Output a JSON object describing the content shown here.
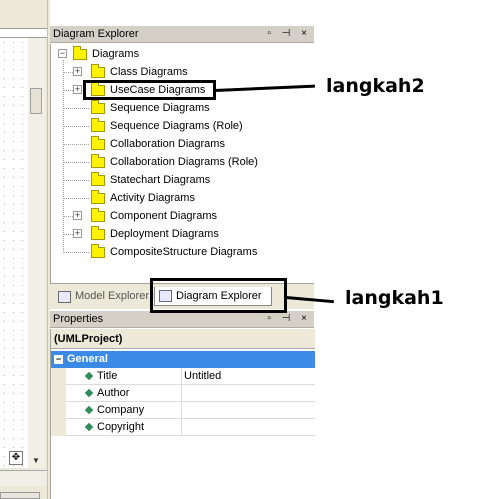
{
  "diagram_explorer": {
    "title": "Diagram Explorer",
    "panel_buttons": "▫ ⊣ ×",
    "root": "Diagrams",
    "items": [
      {
        "label": "Class Diagrams",
        "expandable": true
      },
      {
        "label": "UseCase Diagrams",
        "expandable": true
      },
      {
        "label": "Sequence Diagrams",
        "expandable": false
      },
      {
        "label": "Sequence Diagrams (Role)",
        "expandable": false
      },
      {
        "label": "Collaboration Diagrams",
        "expandable": false
      },
      {
        "label": "Collaboration Diagrams (Role)",
        "expandable": false
      },
      {
        "label": "Statechart Diagrams",
        "expandable": false
      },
      {
        "label": "Activity Diagrams",
        "expandable": false
      },
      {
        "label": "Component Diagrams",
        "expandable": true
      },
      {
        "label": "Deployment Diagrams",
        "expandable": true
      },
      {
        "label": "CompositeStructure Diagrams",
        "expandable": false
      }
    ]
  },
  "tabs": [
    {
      "label": "Model Explorer",
      "icon": "model-explorer-icon"
    },
    {
      "label": "Diagram Explorer",
      "icon": "diagram-explorer-icon"
    }
  ],
  "properties": {
    "title": "Properties",
    "panel_buttons": "▫ ⊣ ×",
    "object": "(UMLProject)",
    "category": "General",
    "rows": [
      {
        "name": "Title",
        "value": "Untitled"
      },
      {
        "name": "Author",
        "value": ""
      },
      {
        "name": "Company",
        "value": ""
      },
      {
        "name": "Copyright",
        "value": ""
      }
    ]
  },
  "annotations": {
    "step2": "langkah2",
    "step1": "langkah1"
  },
  "colors": {
    "folder": "#fff200",
    "category_header": "#3a8ae6",
    "panel_bg": "#ece9d8"
  }
}
